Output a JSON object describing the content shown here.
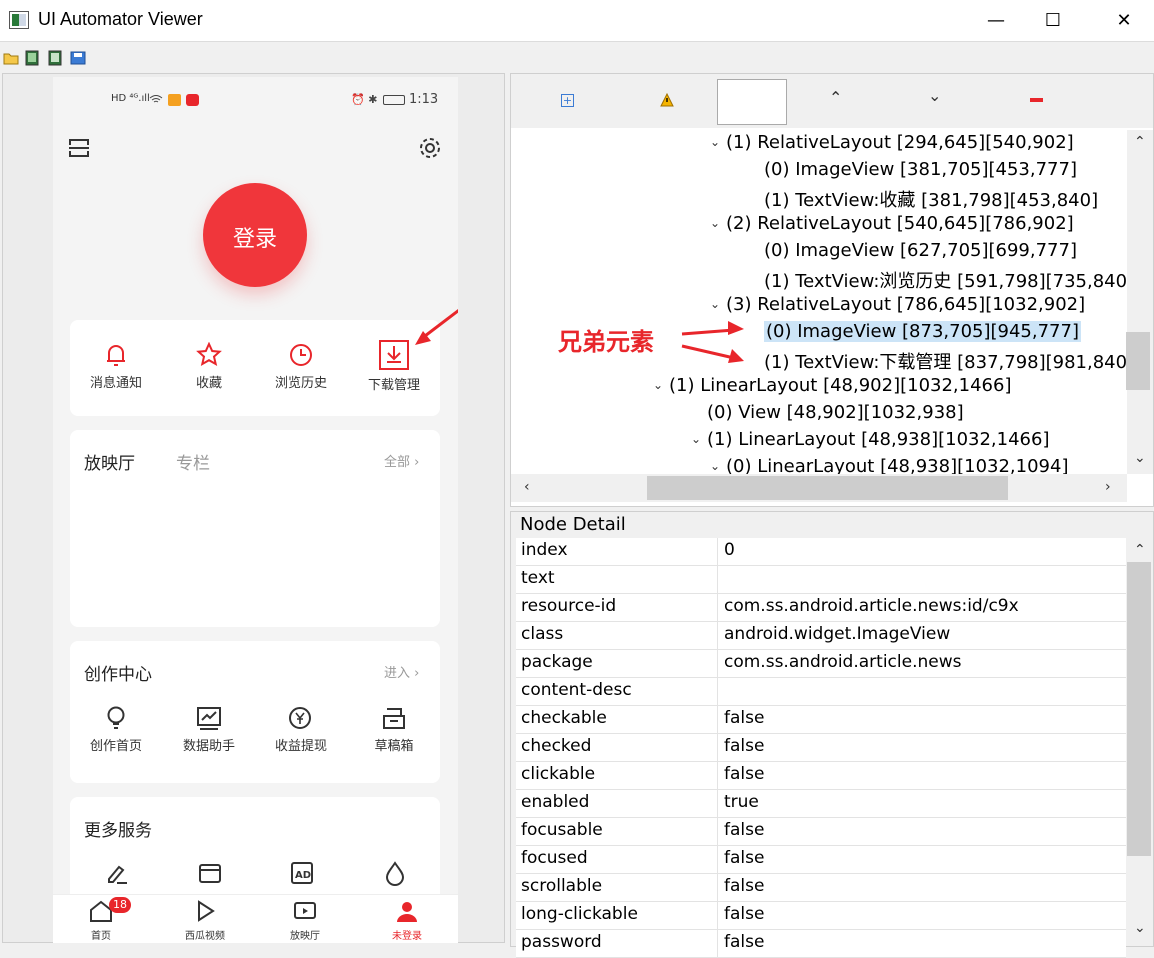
{
  "window": {
    "title": "UI Automator Viewer",
    "minimize": "—",
    "maximize": "☐",
    "close": "✕"
  },
  "phone": {
    "status_left": "HD ⁴ᴳ.ıll",
    "status_time": "1:13",
    "login_label": "登录",
    "quick_items": [
      {
        "label": "消息通知",
        "icon": "bell-icon"
      },
      {
        "label": "收藏",
        "icon": "star-icon"
      },
      {
        "label": "浏览历史",
        "icon": "clock-icon"
      },
      {
        "label": "下载管理",
        "icon": "download-icon"
      }
    ],
    "theater": {
      "tab1": "放映厅",
      "tab2": "专栏",
      "all": "全部 ›"
    },
    "creator": {
      "title": "创作中心",
      "enter": "进入 ›",
      "items": [
        {
          "label": "创作首页",
          "icon": "bulb-icon"
        },
        {
          "label": "数据助手",
          "icon": "chart-icon"
        },
        {
          "label": "收益提现",
          "icon": "yuan-icon"
        },
        {
          "label": "草稿箱",
          "icon": "draft-icon"
        }
      ]
    },
    "more": {
      "title": "更多服务"
    },
    "nav": [
      {
        "label": "首页",
        "badge": "18"
      },
      {
        "label": "西瓜视频"
      },
      {
        "label": "放映厅"
      },
      {
        "label": "未登录"
      }
    ]
  },
  "annotation": {
    "label": "兄弟元素",
    "color": "#e8262b"
  },
  "tree": {
    "rows": [
      {
        "text": "(1) RelativeLayout [294,645][540,902]",
        "caret": "⌄"
      },
      {
        "text": "(0) ImageView [381,705][453,777]"
      },
      {
        "text": "(1) TextView:收藏 [381,798][453,840]"
      },
      {
        "text": "(2) RelativeLayout [540,645][786,902]",
        "caret": "⌄"
      },
      {
        "text": "(0) ImageView [627,705][699,777]"
      },
      {
        "text": "(1) TextView:浏览历史 [591,798][735,840]"
      },
      {
        "text": "(3) RelativeLayout [786,645][1032,902]",
        "caret": "⌄"
      },
      {
        "text": "(0) ImageView [873,705][945,777]",
        "selected": true
      },
      {
        "text": "(1) TextView:下载管理 [837,798][981,840]"
      },
      {
        "text": "(1) LinearLayout [48,902][1032,1466]",
        "caret": "⌄"
      },
      {
        "text": "(0) View [48,902][1032,938]"
      },
      {
        "text": "(1) LinearLayout [48,938][1032,1466]",
        "caret": "⌄"
      },
      {
        "text": "(0) LinearLayout [48,938][1032,1094]",
        "caret": "⌄"
      }
    ]
  },
  "detail": {
    "title": "Node Detail",
    "rows": [
      {
        "k": "index",
        "v": "0"
      },
      {
        "k": "text",
        "v": ""
      },
      {
        "k": "resource-id",
        "v": "com.ss.android.article.news:id/c9x"
      },
      {
        "k": "class",
        "v": "android.widget.ImageView"
      },
      {
        "k": "package",
        "v": "com.ss.android.article.news"
      },
      {
        "k": "content-desc",
        "v": ""
      },
      {
        "k": "checkable",
        "v": "false"
      },
      {
        "k": "checked",
        "v": "false"
      },
      {
        "k": "clickable",
        "v": "false"
      },
      {
        "k": "enabled",
        "v": "true"
      },
      {
        "k": "focusable",
        "v": "false"
      },
      {
        "k": "focused",
        "v": "false"
      },
      {
        "k": "scrollable",
        "v": "false"
      },
      {
        "k": "long-clickable",
        "v": "false"
      },
      {
        "k": "password",
        "v": "false"
      }
    ]
  }
}
